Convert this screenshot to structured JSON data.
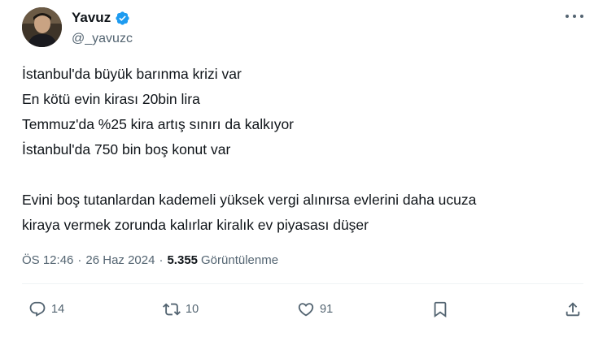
{
  "tweet": {
    "display_name": "Yavuz",
    "handle": "@_yavuzc",
    "lines_paragraph1": [
      "İstanbul'da büyük barınma krizi var",
      "En kötü evin kirası 20bin lira",
      "Temmuz'da %25 kira artış sınırı da kalkıyor",
      "İstanbul'da 750 bin boş konut var"
    ],
    "lines_paragraph2": [
      "Evini boş tutanlardan kademeli yüksek vergi alınırsa evlerini daha ucuza",
      "kiraya vermek zorunda kalırlar kiralık ev piyasası düşer"
    ],
    "time": "ÖS 12:46",
    "separator": "·",
    "date": "26 Haz 2024",
    "views_count": "5.355",
    "views_label": "Görüntülenme"
  },
  "actions": {
    "reply_count": "14",
    "retweet_count": "10",
    "like_count": "91"
  },
  "colors": {
    "verified": "#1d9bf0",
    "secondary_text": "#536471",
    "primary_text": "#0f1419"
  }
}
